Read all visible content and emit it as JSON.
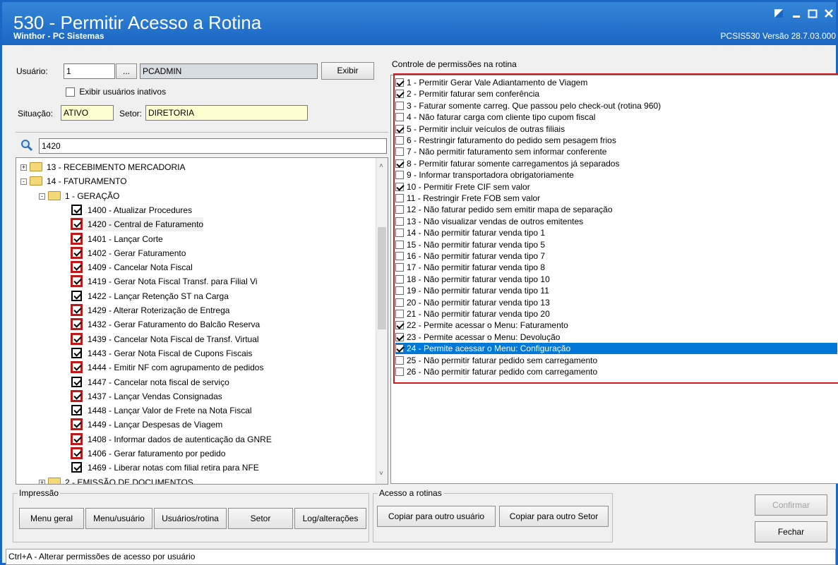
{
  "window": {
    "title": "530 - Permitir Acesso a Rotina",
    "subtitle": "Winthor - PC Sistemas",
    "version": "PCSIS530  Versão  28.7.03.000"
  },
  "user": {
    "usuario_label": "Usuário:",
    "usuario_value": "1",
    "lookup_label": "...",
    "usuario_name": "PCADMIN",
    "exibir_label": "Exibir",
    "inativos_label": "Exibir usuários inativos",
    "situacao_label": "Situação:",
    "situacao_value": "ATIVO",
    "setor_label": "Setor:",
    "setor_value": "DIRETORIA"
  },
  "search": {
    "value": "1420"
  },
  "tree": {
    "items": [
      {
        "label": "13 - RECEBIMENTO MERCADORIA",
        "type": "folder",
        "expander": "+"
      },
      {
        "label": "14 - FATURAMENTO",
        "type": "folder",
        "expander": "-"
      },
      {
        "label": "1 - GERAÇÃO",
        "type": "folder",
        "expander": "-"
      },
      {
        "label": "1400 - Atualizar Procedures",
        "type": "check",
        "red": false
      },
      {
        "label": "1420 - Central de Faturamento",
        "type": "check",
        "red": true
      },
      {
        "label": "1401 - Lançar Corte",
        "type": "check",
        "red": true
      },
      {
        "label": "1402 - Gerar Faturamento",
        "type": "check",
        "red": true
      },
      {
        "label": "1409 - Cancelar Nota Fiscal",
        "type": "check",
        "red": true
      },
      {
        "label": "1419 - Gerar Nota Fiscal Transf. para Filial Vi",
        "type": "check",
        "red": true
      },
      {
        "label": "1422 - Lançar Retenção ST na Carga",
        "type": "check",
        "red": false
      },
      {
        "label": "1429 - Alterar Roterização de Entrega",
        "type": "check",
        "red": true
      },
      {
        "label": "1432 - Gerar Faturamento do Balcão Reserva",
        "type": "check",
        "red": true
      },
      {
        "label": "1439 - Cancelar Nota Fiscal de Transf. Virtual",
        "type": "check",
        "red": true
      },
      {
        "label": "1443 - Gerar Nota Fiscal de Cupons Fiscais",
        "type": "check",
        "red": false
      },
      {
        "label": "1444 - Emitir NF com agrupamento de pedidos",
        "type": "check",
        "red": true
      },
      {
        "label": "1447 - Cancelar nota fiscal de serviço",
        "type": "check",
        "red": false
      },
      {
        "label": "1437 - Lançar Vendas Consignadas",
        "type": "check",
        "red": true
      },
      {
        "label": "1448 - Lançar Valor de Frete na Nota Fiscal",
        "type": "check",
        "red": false
      },
      {
        "label": "1449 - Lançar Despesas de Viagem",
        "type": "check",
        "red": true
      },
      {
        "label": "1408 - Informar dados de autenticação da GNRE",
        "type": "check",
        "red": true
      },
      {
        "label": "1406 - Gerar faturamento por pedido",
        "type": "check",
        "red": true
      },
      {
        "label": "1469 - Liberar notas com filial retira para NFE",
        "type": "check",
        "red": false
      },
      {
        "label": "2 - EMISSÃO DE DOCUMENTOS",
        "type": "folder",
        "expander": "+"
      }
    ]
  },
  "permissions": {
    "header": "Controle de permissões na rotina",
    "items": [
      {
        "label": "1 - Permitir Gerar Vale Adiantamento de Viagem",
        "checked": true
      },
      {
        "label": "2 - Permitir faturar sem conferência",
        "checked": true
      },
      {
        "label": "3 - Faturar somente carreg. Que passou pelo check-out (rotina 960)",
        "checked": false
      },
      {
        "label": "4 - Não faturar carga com cliente tipo cupom fiscal",
        "checked": false
      },
      {
        "label": "5 - Permitir incluir veículos de outras filiais",
        "checked": true
      },
      {
        "label": "6 - Restringir faturamento do pedido sem pesagem frios",
        "checked": false
      },
      {
        "label": "7 - Não permitir faturamento sem informar conferente",
        "checked": false
      },
      {
        "label": "8 - Permitir faturar somente carregamentos já separados",
        "checked": true
      },
      {
        "label": "9 - Informar transportadora obrigatoriamente",
        "checked": false
      },
      {
        "label": "10 - Permitir Frete CIF sem valor",
        "checked": true
      },
      {
        "label": "11 - Restringir Frete FOB sem valor",
        "checked": false
      },
      {
        "label": "12 - Não faturar pedido sem emitir mapa de separação",
        "checked": false
      },
      {
        "label": "13 - Não visualizar vendas de outros emitentes",
        "checked": false
      },
      {
        "label": "14 - Não permitir faturar venda tipo 1",
        "checked": false
      },
      {
        "label": "15 - Não permitir faturar venda tipo 5",
        "checked": false
      },
      {
        "label": "16 - Não permitir faturar venda tipo 7",
        "checked": false
      },
      {
        "label": "17 - Não permitir faturar venda tipo 8",
        "checked": false
      },
      {
        "label": "18 - Não permitir faturar venda tipo 10",
        "checked": false
      },
      {
        "label": "19 - Não permitir faturar venda tipo 11",
        "checked": false
      },
      {
        "label": "20 - Não permitir faturar venda tipo 13",
        "checked": false
      },
      {
        "label": "21 - Não permitir faturar venda tipo 20",
        "checked": false
      },
      {
        "label": "22 - Permite acessar o Menu: Faturamento",
        "checked": true
      },
      {
        "label": "23 - Permite acessar o Menu: Devolução",
        "checked": true
      },
      {
        "label": "24 - Permite acessar o Menu: Configuração",
        "checked": true,
        "selected": true
      },
      {
        "label": "25 - Não permitir faturar pedido sem carregamento",
        "checked": false
      },
      {
        "label": "26 - Não permitir faturar pedido com carregamento",
        "checked": false
      }
    ]
  },
  "impressao": {
    "title": "Impressão",
    "buttons": [
      "Menu geral",
      "Menu/usuário",
      "Usuários/rotina",
      "Setor",
      "Log/alterações"
    ]
  },
  "acesso": {
    "title": "Acesso a rotinas",
    "buttons": [
      "Copiar para outro usuário",
      "Copiar para outro Setor"
    ]
  },
  "actions": {
    "confirmar": "Confirmar",
    "fechar": "Fechar"
  },
  "status": {
    "text": "Ctrl+A - Alterar permissões de acesso por usuário"
  },
  "colors": {
    "titlebar": "#1a66c4",
    "highlight_red": "#d0191a",
    "selection_blue": "#0078d7",
    "field_yellow": "#ffffd2"
  }
}
